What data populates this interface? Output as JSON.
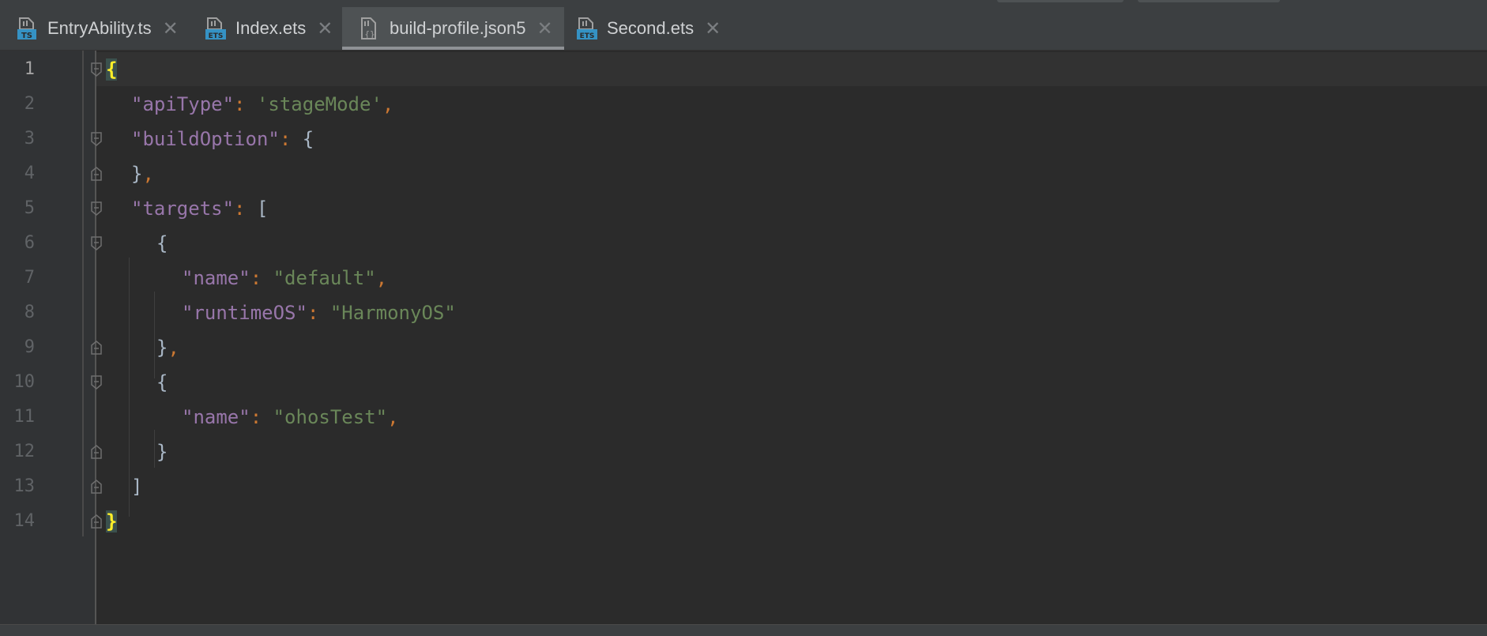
{
  "tabs": [
    {
      "label": "EntryAbility.ts",
      "icon": "ts-file-icon",
      "active": false
    },
    {
      "label": "Index.ets",
      "icon": "ets-file-icon",
      "active": false
    },
    {
      "label": "build-profile.json5",
      "icon": "json5-file-icon",
      "active": true
    },
    {
      "label": "Second.ets",
      "icon": "ets-file-icon",
      "active": false
    }
  ],
  "tab_close_glyph": "✕",
  "icon_badges": {
    "ts": "TS",
    "ets": "ETS"
  },
  "line_numbers": [
    "1",
    "2",
    "3",
    "4",
    "5",
    "6",
    "7",
    "8",
    "9",
    "10",
    "11",
    "12",
    "13",
    "14"
  ],
  "code": {
    "l1_brace": "{",
    "l2_key": "\"apiType\"",
    "l2_colon": ":",
    "l2_val": "'stageMode'",
    "l2_comma": ",",
    "l3_key": "\"buildOption\"",
    "l3_colon": ":",
    "l3_brace": "{",
    "l4_brace": "}",
    "l4_comma": ",",
    "l5_key": "\"targets\"",
    "l5_colon": ":",
    "l5_bracket": "[",
    "l6_brace": "{",
    "l7_key": "\"name\"",
    "l7_colon": ":",
    "l7_val": "\"default\"",
    "l7_comma": ",",
    "l8_key": "\"runtimeOS\"",
    "l8_colon": ":",
    "l8_val": "\"HarmonyOS\"",
    "l9_brace": "}",
    "l9_comma": ",",
    "l10_brace": "{",
    "l11_key": "\"name\"",
    "l11_colon": ":",
    "l11_val": "\"ohosTest\"",
    "l11_comma": ",",
    "l12_brace": "}",
    "l13_bracket": "]",
    "l14_brace": "}"
  },
  "colors": {
    "background": "#2b2b2b",
    "key": "#9876aa",
    "string": "#6a8759",
    "punctuation": "#cc7832",
    "brace_match": "#ffef28"
  }
}
